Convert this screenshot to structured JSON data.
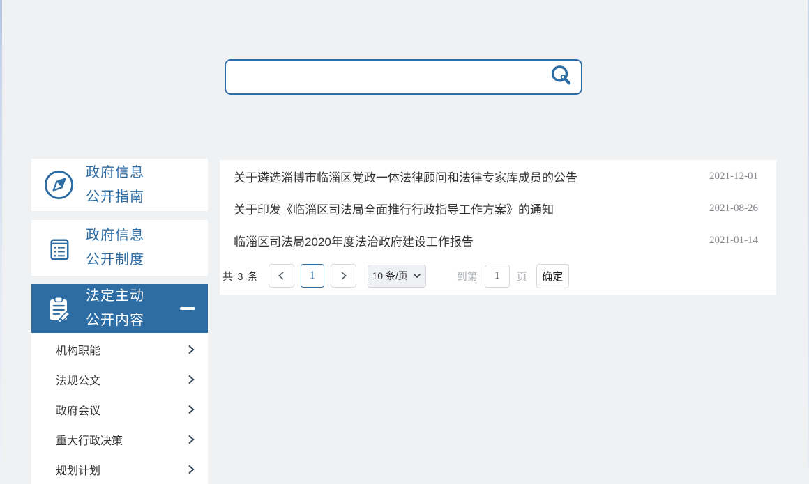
{
  "page": {
    "background": "#f0f1f2",
    "accent_blue": "#2e6da4",
    "panel_white": "#ffffff",
    "date_gray": "#84888d",
    "muted_gray": "#a9adb3"
  },
  "icons": {
    "search": "magnifier-key-icon",
    "guide": "compass-icon",
    "system": "notebook-icon",
    "active": "clipboard-pen-icon",
    "collapse": "minus-icon",
    "submenu_arrow": "chevron-right-icon",
    "prev": "chevron-left-icon",
    "next": "chevron-right-icon",
    "select_arrow": "chevron-down-icon"
  },
  "search": {
    "value": "",
    "placeholder": ""
  },
  "sidebar": {
    "items": [
      {
        "line1": "政府信息",
        "line2": "公开指南",
        "active": false
      },
      {
        "line1": "政府信息",
        "line2": "公开制度",
        "active": false
      },
      {
        "line1": "法定主动",
        "line2": "公开内容",
        "active": true
      }
    ],
    "submenu": [
      {
        "label": "机构职能"
      },
      {
        "label": "法规公文"
      },
      {
        "label": "政府会议"
      },
      {
        "label": "重大行政决策"
      },
      {
        "label": "规划计划"
      }
    ]
  },
  "list": {
    "items": [
      {
        "title": "关于遴选淄博市临淄区党政一体法律顾问和法律专家库成员的公告",
        "date": "2021-12-01"
      },
      {
        "title": "关于印发《临淄区司法局全面推行行政指导工作方案》的通知",
        "date": "2021-08-26"
      },
      {
        "title": "临淄区司法局2020年度法治政府建设工作报告",
        "date": "2021-01-14"
      }
    ]
  },
  "pagination": {
    "total_label": "共 3 条",
    "current_page": "1",
    "page_size_label": "10 条/页",
    "goto_prefix": "到第",
    "goto_value": "1",
    "goto_suffix": "页",
    "confirm_label": "确定"
  }
}
